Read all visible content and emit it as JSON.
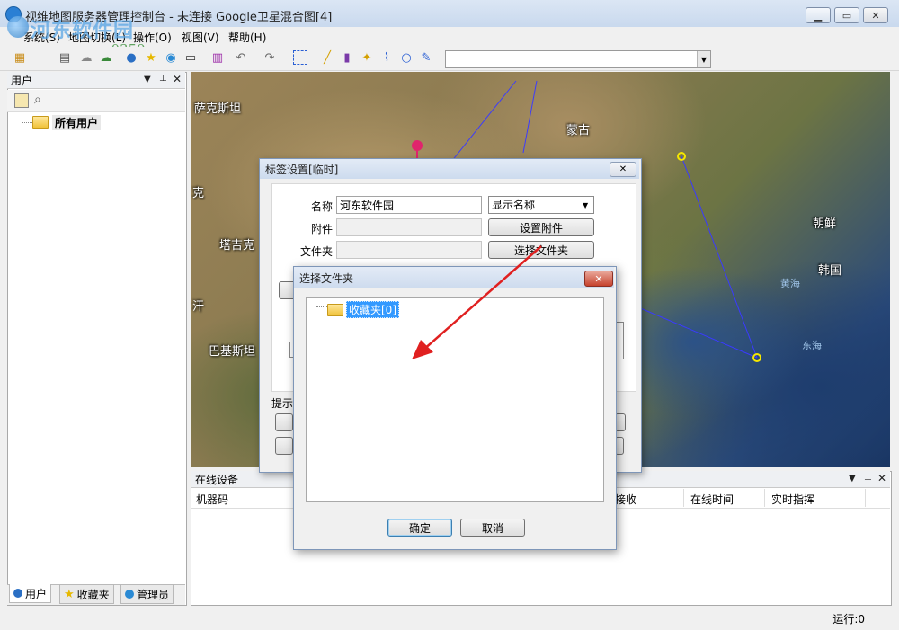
{
  "window": {
    "title": "视维地图服务器管理控制台 - 未连接  Google卫星混合图[4]",
    "controls": [
      "minimize-icon",
      "maximize-icon",
      "close-icon"
    ]
  },
  "watermark": {
    "title": "河东软件园",
    "url": "www.pc0359.cn"
  },
  "menu": {
    "items": [
      "系统(S)",
      "地图切换(L)",
      "操作(O)",
      "视图(V)",
      "帮助(H)"
    ]
  },
  "toolbar": {
    "icons": [
      "layers-icon",
      "line-icon",
      "document-icon",
      "cloud-icon",
      "cloud-upload-icon",
      "user-add-icon",
      "star-icon",
      "globe-icon",
      "laptop-icon",
      "trash-icon",
      "undo-icon",
      "redo-icon",
      "select-rect-icon",
      "pencil-icon",
      "ruler-icon",
      "star-tool-icon",
      "polyline-icon",
      "circle-icon",
      "pen-icon"
    ],
    "combo_value": ""
  },
  "left_panel": {
    "title": "用户",
    "controls": [
      "dropdown-icon",
      "pin-icon",
      "close-icon"
    ],
    "tree_root": "所有用户",
    "tabs": [
      {
        "label": "用户",
        "icon": "user-icon"
      },
      {
        "label": "收藏夹",
        "icon": "star-icon"
      },
      {
        "label": "管理员",
        "icon": "admin-icon"
      }
    ]
  },
  "map": {
    "labels": [
      "萨克斯坦",
      "蒙古",
      "克",
      "塔吉克",
      "汗",
      "巴基斯坦",
      "朝鲜",
      "韩国",
      "黄海",
      "东海"
    ],
    "colors": {
      "route": "#3a3aff",
      "marker_ring": "#f5e600",
      "pin": "#e0246c"
    }
  },
  "device_panel": {
    "title": "在线设备",
    "controls": [
      "dropdown-icon",
      "pin-icon",
      "close-icon"
    ],
    "columns": [
      "机器码",
      "接收",
      "在线时间",
      "实时指挥"
    ]
  },
  "status": {
    "text": "运行:0"
  },
  "label_dialog": {
    "title": "标签设置[临时]",
    "fields": {
      "name_label": "名称",
      "name_value": "河东软件园",
      "attach_label": "附件",
      "folder_label": "文件夹"
    },
    "display_select": "显示名称",
    "buttons": {
      "attach": "设置附件",
      "folder": "选择文件夹"
    },
    "hint": "提示"
  },
  "folder_dialog": {
    "title": "选择文件夹",
    "tree_node": "收藏夹[0]",
    "buttons": {
      "ok": "确定",
      "cancel": "取消"
    }
  },
  "annotation": {
    "arrow_color": "#e02020"
  }
}
